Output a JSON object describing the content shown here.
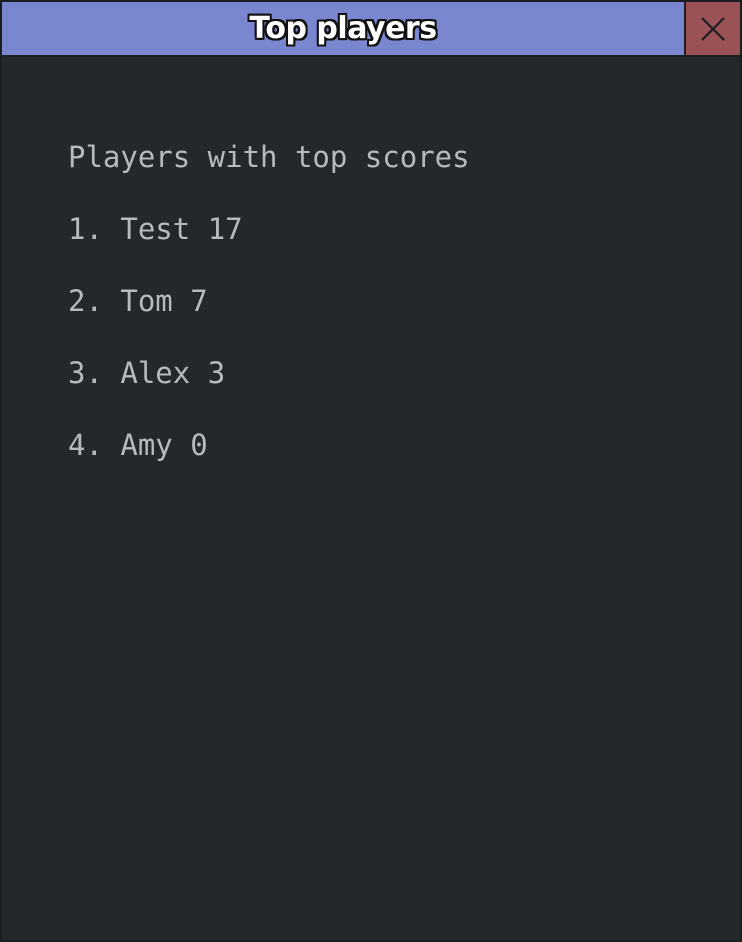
{
  "window": {
    "title": "Top players",
    "close_icon": "close-icon"
  },
  "content": {
    "heading": "Players with top scores",
    "players": [
      {
        "rank": "1.",
        "name": "Test",
        "score": "17"
      },
      {
        "rank": "2.",
        "name": "Tom",
        "score": "7"
      },
      {
        "rank": "3.",
        "name": "Alex",
        "score": "3"
      },
      {
        "rank": "4.",
        "name": "Amy",
        "score": "0"
      }
    ]
  },
  "colors": {
    "titlebar": "#7a86cf",
    "close_button": "#9a5257",
    "background": "#24282c",
    "text": "#b7babd"
  }
}
